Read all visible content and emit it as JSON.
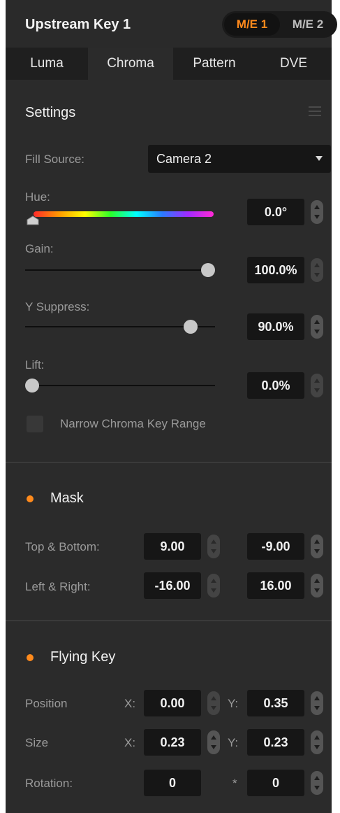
{
  "header": {
    "title": "Upstream Key 1",
    "me_buttons": [
      "M/E 1",
      "M/E 2"
    ],
    "active_me": "M/E 1"
  },
  "tabs": [
    "Luma",
    "Chroma",
    "Pattern",
    "DVE"
  ],
  "active_tab": "Chroma",
  "settings": {
    "title": "Settings",
    "fill_source_label": "Fill Source:",
    "fill_source_value": "Camera 2",
    "hue_label": "Hue:",
    "hue_value": "0.0°",
    "gain_label": "Gain:",
    "gain_value": "100.0%",
    "gain_level": 1.0,
    "y_suppress_label": "Y Suppress:",
    "y_suppress_value": "90.0%",
    "y_suppress_level": 0.9,
    "lift_label": "Lift:",
    "lift_value": "0.0%",
    "lift_level": 0.0,
    "narrow_range_label": "Narrow Chroma Key Range",
    "narrow_range_checked": false
  },
  "mask": {
    "title": "Mask",
    "top_bottom_label": "Top & Bottom:",
    "top_value": "9.00",
    "bottom_value": "-9.00",
    "left_right_label": "Left & Right:",
    "left_value": "-16.00",
    "right_value": "16.00"
  },
  "flying_key": {
    "title": "Flying Key",
    "position_label": "Position",
    "size_label": "Size",
    "rotation_label": "Rotation:",
    "x_label": "X:",
    "y_label": "Y:",
    "position_x": "0.00",
    "position_y": "0.35",
    "size_x": "0.23",
    "size_y": "0.23",
    "rotation_value": "0",
    "rotation_link": "*",
    "rotation_value_2": "0"
  },
  "colors": {
    "accent": "#ff8a1c",
    "panel_bg": "#2b2b2b",
    "field_bg": "#161616"
  }
}
